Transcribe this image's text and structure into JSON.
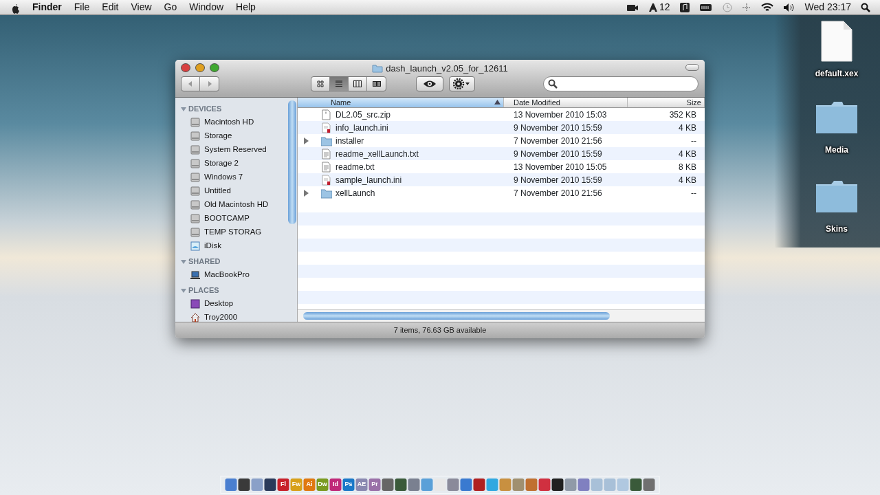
{
  "menu_bar": {
    "menus": [
      {
        "label": "Finder",
        "bold": true
      },
      {
        "label": "File",
        "bold": false
      },
      {
        "label": "Edit",
        "bold": false
      },
      {
        "label": "View",
        "bold": false
      },
      {
        "label": "Go",
        "bold": false
      },
      {
        "label": "Window",
        "bold": false
      },
      {
        "label": "Help",
        "bold": false
      }
    ],
    "status": [
      "12",
      "Wed 23:17"
    ]
  },
  "window": {
    "title": "dash_launch_v2.05_for_12611",
    "view_modes": [
      {
        "kind": "icons",
        "selected": false
      },
      {
        "kind": "list",
        "selected": true
      },
      {
        "kind": "columns",
        "selected": false
      },
      {
        "kind": "coverflow",
        "selected": false
      }
    ],
    "sidebar": [
      {
        "heading": "DEVICES",
        "expanded": true,
        "items": [
          {
            "label": "Macintosh HD",
            "kind": "disk"
          },
          {
            "label": "Storage",
            "kind": "disk"
          },
          {
            "label": "System Reserved",
            "kind": "disk"
          },
          {
            "label": "Storage 2",
            "kind": "disk"
          },
          {
            "label": "Windows 7",
            "kind": "disk"
          },
          {
            "label": "Untitled",
            "kind": "disk"
          },
          {
            "label": "Old Macintosh HD",
            "kind": "disk"
          },
          {
            "label": "BOOTCAMP",
            "kind": "disk"
          },
          {
            "label": "TEMP STORAG",
            "kind": "disk"
          },
          {
            "label": "iDisk",
            "kind": "idisk"
          }
        ]
      },
      {
        "heading": "SHARED",
        "expanded": true,
        "items": [
          {
            "label": "MacBookPro",
            "kind": "computer"
          }
        ]
      },
      {
        "heading": "PLACES",
        "expanded": true,
        "items": [
          {
            "label": "Desktop",
            "kind": "desktop"
          },
          {
            "label": "Troy2000",
            "kind": "home"
          }
        ]
      }
    ],
    "table": {
      "columns": [
        {
          "label": "Name",
          "sorted": true
        },
        {
          "label": "Date Modified",
          "sorted": false
        },
        {
          "label": "Size",
          "sorted": false
        }
      ],
      "rows": [
        {
          "name": "DL2.05_src.zip",
          "kind": "zip",
          "date": "13 November 2010 15:03",
          "size": "352 KB"
        },
        {
          "name": "info_launch.ini",
          "kind": "ini",
          "date": "9 November 2010 15:59",
          "size": "4 KB"
        },
        {
          "name": "installer",
          "kind": "folder",
          "expanded": false,
          "date": "7 November 2010 21:56",
          "size": "--"
        },
        {
          "name": "readme_xellLaunch.txt",
          "kind": "txt",
          "date": "9 November 2010 15:59",
          "size": "4 KB"
        },
        {
          "name": "readme.txt",
          "kind": "txt",
          "date": "13 November 2010 15:05",
          "size": "8 KB"
        },
        {
          "name": "sample_launch.ini",
          "kind": "ini",
          "date": "9 November 2010 15:59",
          "size": "4 KB"
        },
        {
          "name": "xellLaunch",
          "kind": "folder",
          "expanded": false,
          "date": "7 November 2010 21:56",
          "size": "--"
        }
      ]
    },
    "status_bar": "7 items, 76.63 GB available"
  },
  "desktop_icons": [
    {
      "label": "default.xex",
      "kind": "file"
    },
    {
      "label": "Media",
      "kind": "folder"
    },
    {
      "label": "Skins",
      "kind": "folder"
    }
  ],
  "dock": [
    {
      "color": "#4a7fd0"
    },
    {
      "color": "#3a3a3a"
    },
    {
      "color": "#8aa0c8"
    },
    {
      "color": "#2a3a5a"
    },
    {
      "label": "Fl",
      "color": "#c8202a"
    },
    {
      "label": "Fw",
      "color": "#d8a018"
    },
    {
      "label": "Ai",
      "color": "#e07810"
    },
    {
      "label": "Dw",
      "color": "#7a9a20"
    },
    {
      "label": "Id",
      "color": "#c02878"
    },
    {
      "label": "Ps",
      "color": "#1a78c8"
    },
    {
      "label": "AE",
      "color": "#8a88b0"
    },
    {
      "label": "Pr",
      "color": "#9a70a8"
    },
    {
      "color": "#666666"
    },
    {
      "color": "#3a5a3a"
    },
    {
      "color": "#7a8090"
    },
    {
      "color": "#5aa0d8"
    },
    {
      "color": "#e8e8e8"
    },
    {
      "color": "#8a8a9a"
    },
    {
      "color": "#3a7ad0"
    },
    {
      "color": "#b02020"
    },
    {
      "color": "#30a8e0"
    },
    {
      "color": "#c89040"
    },
    {
      "color": "#a09070"
    },
    {
      "color": "#c07030"
    },
    {
      "color": "#d03040"
    },
    {
      "color": "#202020"
    },
    {
      "color": "#909aa8"
    },
    {
      "color": "#8080c0"
    },
    {
      "color": "#a8c0d8"
    },
    {
      "color": "#a8c0d8"
    },
    {
      "color": "#b0c8e0"
    },
    {
      "color": "#3a5a3a"
    },
    {
      "color": "#707070"
    }
  ]
}
